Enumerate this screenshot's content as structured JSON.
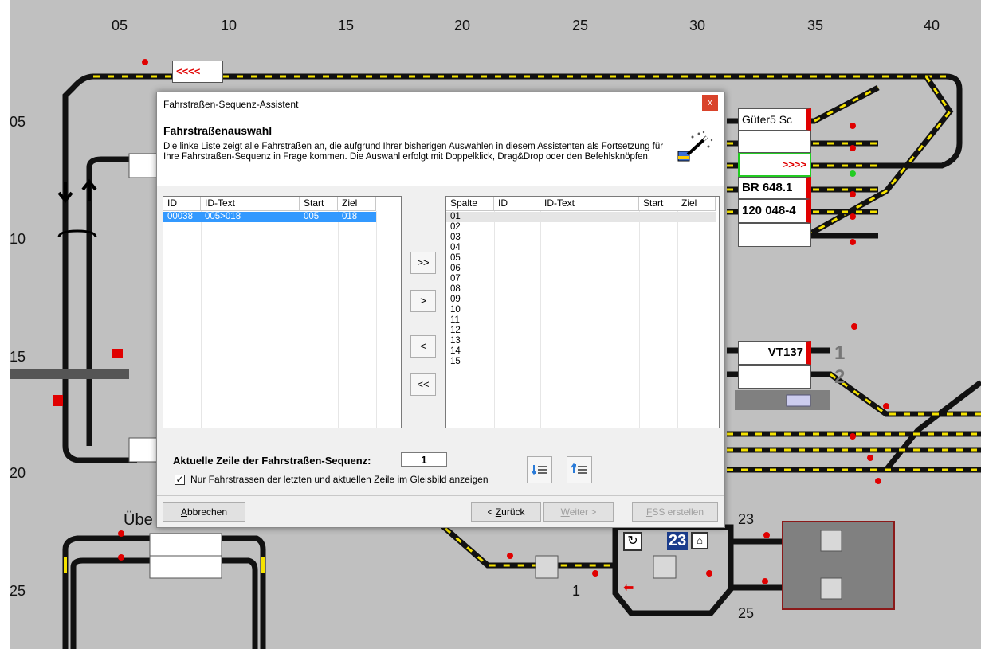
{
  "board": {
    "col_numbers": [
      "05",
      "10",
      "15",
      "20",
      "25",
      "30",
      "35",
      "40"
    ],
    "row_numbers": [
      "05",
      "10",
      "15",
      "20",
      "25"
    ],
    "blocks": {
      "left_top_arrows": "<<<<",
      "gueter": "Güter5 Sc",
      "right_arrows": ">>>>",
      "br": "BR 648.1",
      "lok": "120 048-4",
      "vt": "VT137",
      "track1": "1",
      "track2": "2",
      "uebe": "Übe",
      "num23a": "23",
      "num23b": "23",
      "num1": "1",
      "num25": "25"
    },
    "colors": {
      "track": "#111111",
      "yellow": "#f5e200",
      "red": "#e00000",
      "green": "#22cc22",
      "board": "#c0c0c0"
    }
  },
  "dialog": {
    "title": "Fahrstraßen-Sequenz-Assistent",
    "close_label": "x",
    "heading": "Fahrstraßenauswahl",
    "description": "Die linke Liste zeigt alle Fahrstraßen an, die aufgrund Ihrer bisherigen Auswahlen in diesem Assistenten als Fortsetzung für Ihre Fahrstraßen-Sequenz in Frage kommen. Die Auswahl erfolgt mit Doppelklick, Drag&Drop oder den Befehlsknöpfen.",
    "left_list": {
      "columns": [
        "ID",
        "ID-Text",
        "Start",
        "Ziel"
      ],
      "rows": [
        {
          "id": "00038",
          "text": "005>018",
          "start": "005",
          "ziel": "018"
        }
      ]
    },
    "right_list": {
      "columns": [
        "Spalte",
        "ID",
        "ID-Text",
        "Start",
        "Ziel"
      ],
      "rows": [
        "01",
        "02",
        "03",
        "04",
        "05",
        "06",
        "07",
        "08",
        "09",
        "10",
        "11",
        "12",
        "13",
        "14",
        "15"
      ]
    },
    "move_buttons": {
      "all_right": ">>",
      "right": ">",
      "left": "<",
      "all_left": "<<"
    },
    "current_line_label": "Aktuelle Zeile der Fahrstraßen-Sequenz:",
    "current_line_value": "1",
    "checkbox_label": "Nur Fahrstrassen der letzten und aktuellen Zeile im Gleisbild anzeigen",
    "checkbox_checked": true,
    "buttons": {
      "cancel_rest": "bbrechen",
      "cancel_first": "A",
      "back_prefix": "< ",
      "back_key": "Z",
      "back_rest": "urück",
      "next_key": "W",
      "next_rest": "eiter >",
      "create_key": "F",
      "create_rest": "SS erstellen"
    },
    "icons": [
      "magic-wand-icon",
      "insert-line-icon",
      "remove-line-icon"
    ]
  }
}
